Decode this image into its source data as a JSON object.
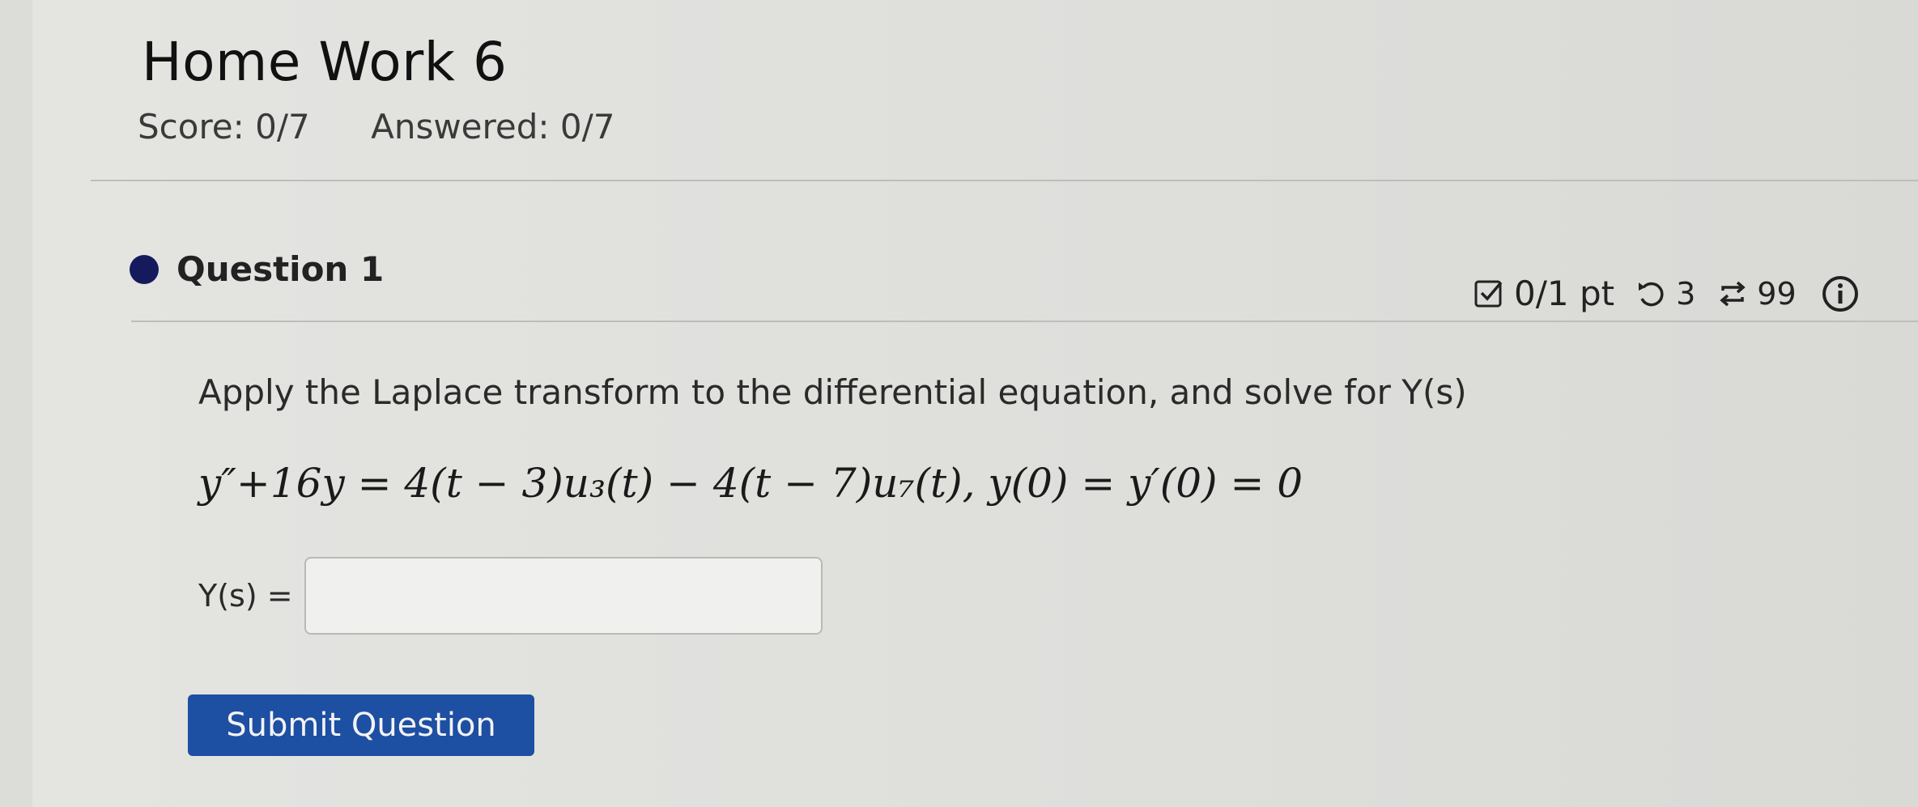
{
  "assignment": {
    "title": "Home Work 6",
    "score": "Score: 0/7",
    "answered": "Answered: 0/7"
  },
  "question": {
    "label": "Question 1",
    "points": "0/1 pt",
    "retries": "3",
    "attempts": "99",
    "prompt": "Apply the Laplace transform to the differential equation, and solve for Y(s)",
    "equation": "y″+16y = 4(t − 3)u₃(t) − 4(t − 7)u₇(t),  y(0) = y′(0) = 0",
    "answer_label": "Y(s) =",
    "answer_value": ""
  },
  "submit_label": "Submit Question",
  "icons": {
    "status": "filled-circle-icon",
    "points": "checkbox-icon",
    "retry": "retry-icon",
    "attempts": "repeat-icon",
    "info": "info-icon"
  },
  "colors": {
    "submit_button": "#1d4fa3",
    "status_dot": "#141a5c"
  }
}
